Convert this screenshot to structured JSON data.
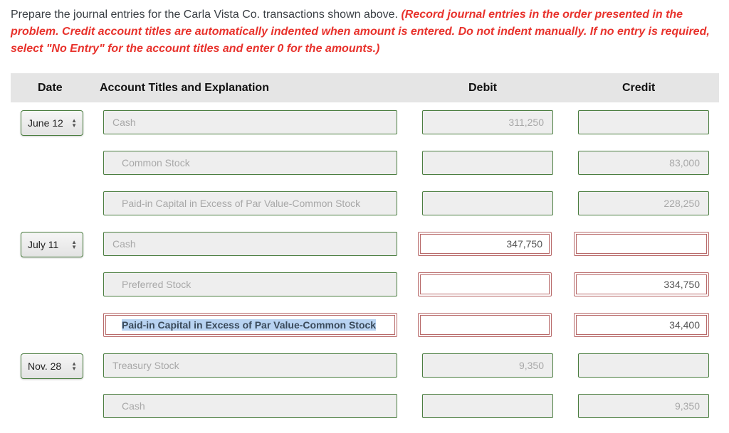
{
  "instructions": {
    "plain": "Prepare the journal entries for the Carla Vista Co. transactions shown above. ",
    "emphasis": "(Record journal entries in the order presented in the problem. Credit account titles are automatically indented when amount is entered. Do not indent manually. If no entry is required, select \"No Entry\" for the account titles and enter 0 for the amounts.)"
  },
  "table": {
    "headers": {
      "date": "Date",
      "account": "Account Titles and Explanation",
      "debit": "Debit",
      "credit": "Credit"
    },
    "entries": [
      {
        "date": "June 12",
        "lines": [
          {
            "account": "Cash",
            "debit": "311,250",
            "credit": ""
          },
          {
            "account": "Common Stock",
            "debit": "",
            "credit": "83,000"
          },
          {
            "account": "Paid-in Capital in Excess of Par Value-Common Stock",
            "debit": "",
            "credit": "228,250"
          }
        ]
      },
      {
        "date": "July 11",
        "lines": [
          {
            "account": "Cash",
            "debit": "347,750",
            "credit": ""
          },
          {
            "account": "Preferred Stock",
            "debit": "",
            "credit": "334,750"
          },
          {
            "account": "Paid-in Capital in Excess of Par Value-Common Stock",
            "debit": "",
            "credit": "34,400"
          }
        ]
      },
      {
        "date": "Nov. 28",
        "lines": [
          {
            "account": "Treasury Stock",
            "debit": "9,350",
            "credit": ""
          },
          {
            "account": "Cash",
            "debit": "",
            "credit": "9,350"
          }
        ]
      }
    ]
  },
  "colors": {
    "emphasis_red": "#e8322c",
    "field_border_green": "#4a7d3f",
    "field_border_error": "#b86a6a",
    "header_bg": "#e5e5e5",
    "selection_bg": "#b8d3f2"
  }
}
